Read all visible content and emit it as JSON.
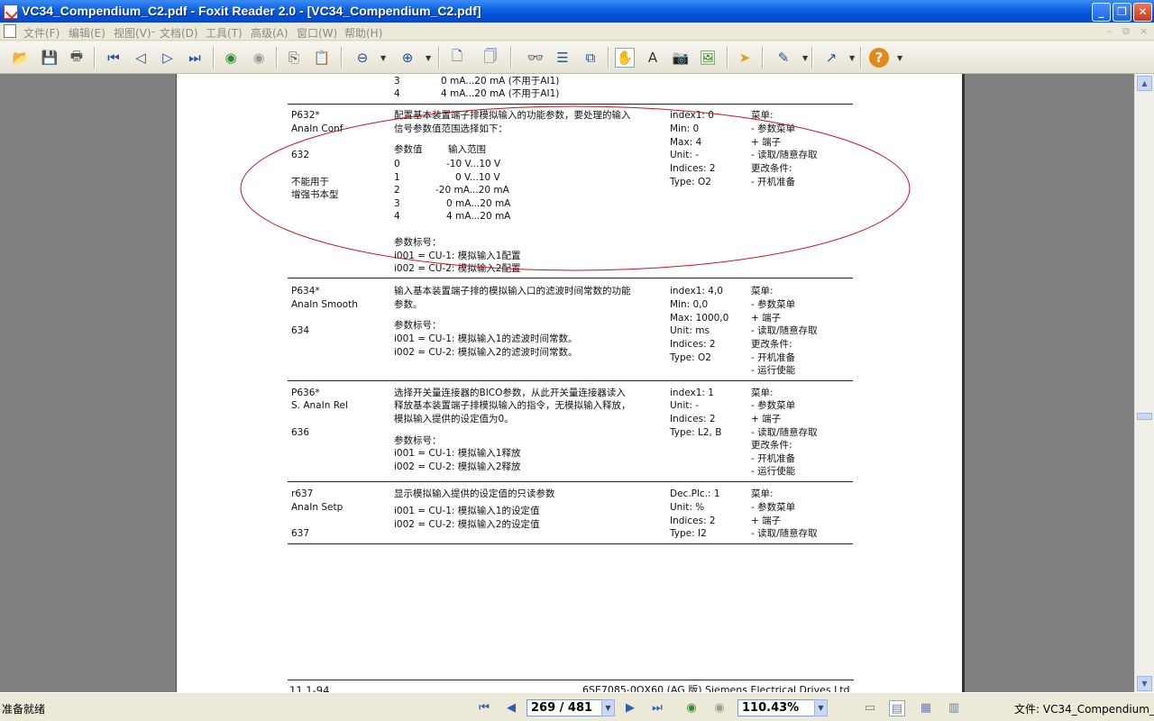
{
  "window": {
    "title": "VC34_Compendium_C2.pdf - Foxit Reader 2.0 - [VC34_Compendium_C2.pdf]",
    "min": "_",
    "max": "❐",
    "close": "✕"
  },
  "menu": [
    "文件(F)",
    "编辑(E)",
    "视图(V)",
    "文档(D)",
    "工具(T)",
    "高级(A)",
    "窗口(W)",
    "帮助(H)"
  ],
  "menu_sep": "-",
  "mdi": {
    "min": "–",
    "restore": "⧉",
    "close": "×"
  },
  "toolbar": {
    "icons": [
      "open-icon",
      "save-icon",
      "print-icon",
      "first-page-icon",
      "prev-page-icon",
      "next-page-icon",
      "last-page-icon",
      "back-icon",
      "forward-icon",
      "copy-icon",
      "paste-icon",
      "zoom-out-icon",
      "zoom-in-icon",
      "actual-size-icon",
      "fit-page-icon",
      "binoculars-icon",
      "text-view-icon",
      "thumbnail-icon",
      "hand-icon",
      "select-text-icon",
      "snapshot-icon",
      "image-icon",
      "arrow-icon",
      "pencil-icon",
      "line-icon",
      "help-icon"
    ]
  },
  "doc": {
    "top_rows": [
      {
        "a": "3",
        "b": "0 mA...20 mA (不用于AI1)"
      },
      {
        "a": "4",
        "b": "4 mA...20 mA (不用于AI1)"
      }
    ],
    "p632": {
      "id": "P632*",
      "name": "AnaIn Conf",
      "num": "632",
      "note1": "不能用于",
      "note2": "增强书本型",
      "desc1": "配置基本装置端子排模拟输入的功能参数，要处理的输入",
      "desc2": "信号参数值范围选择如下：",
      "hdr_val": "参数值",
      "hdr_range": "输入范围",
      "vals": [
        {
          "v": "0",
          "r": "-10 V...10 V"
        },
        {
          "v": "1",
          "r": "0 V...10 V"
        },
        {
          "v": "2",
          "r": "-20 mA...20 mA"
        },
        {
          "v": "3",
          "r": "0 mA...20 mA"
        },
        {
          "v": "4",
          "r": "4 mA...20 mA"
        }
      ],
      "idx_title": "参数标号：",
      "i1": "i001 = CU-1: 模拟输入1配置",
      "i2": "i002 = CU-2: 模拟输入2配置",
      "attrs": [
        "index1: 0",
        "Min: 0",
        "Max: 4",
        "Unit: -",
        "Indices: 2",
        "Type: O2"
      ],
      "menu": [
        "菜单:",
        "-  参数菜单",
        "     + 端子",
        "-  读取/随意存取",
        "更改条件:",
        "-  开机准备"
      ]
    },
    "p634": {
      "id": "P634*",
      "name": "AnaIn Smooth",
      "num": "634",
      "desc1": "输入基本装置端子排的模拟输入口的滤波时间常数的功能",
      "desc2": "参数。",
      "idx_title": "参数标号：",
      "i1": "i001 = CU-1: 模拟输入1的滤波时间常数。",
      "i2": "i002 = CU-2: 模拟输入2的滤波时间常数。",
      "attrs": [
        "index1: 4,0",
        "Min: 0,0",
        "Max: 1000,0",
        "Unit: ms",
        "Indices: 2",
        "Type: O2"
      ],
      "menu": [
        "菜单:",
        "-  参数菜单",
        "     + 端子",
        "-  读取/随意存取",
        "更改条件:",
        "-  开机准备",
        "-  运行使能"
      ]
    },
    "p636": {
      "id": "P636*",
      "name": "S. AnaIn Rel",
      "num": "636",
      "desc1": "选择开关量连接器的BICO参数，从此开关量连接器读入",
      "desc2": "释放基本装置端子排模拟输入的指令，无模拟输入释放，",
      "desc3": "模拟输入提供的设定值为0。",
      "idx_title": "参数标号：",
      "i1": " i001 = CU-1: 模拟输入1释放",
      "i2": " i002 = CU-2: 模拟输入2释放",
      "attrs": [
        "index1: 1",
        "Unit: -",
        "Indices: 2",
        "Type: L2, B"
      ],
      "menu": [
        "菜单:",
        "-  参数菜单",
        "     + 端子",
        "-  读取/随意存取",
        "更改条件:",
        "-  开机准备",
        "-  运行使能"
      ]
    },
    "r637": {
      "id": "r637",
      "name": "AnaIn Setp",
      "num": "637",
      "desc1": "显示模拟输入提供的设定值的只读参数",
      "i1": "i001 = CU-1: 模拟输入1的设定值",
      "i2": "i002 = CU-2: 模拟输入2的设定值",
      "attrs": [
        "Dec.Plc.: 1",
        "Unit: %",
        "Indices: 2",
        "Type: I2"
      ],
      "menu": [
        "菜单:",
        "-  参数菜单",
        "     + 端子",
        "-  读取/随意存取"
      ]
    },
    "footer_left": "11.1-94",
    "footer_right": "6SE7085-0QX60 (AG 版)  Siemens Electrical Drives Ltd"
  },
  "status": {
    "ready": "准备就绪",
    "page": "269 / 481",
    "zoom": "110.43%",
    "file": "文件: VC34_Compendium_C2.pdf"
  }
}
